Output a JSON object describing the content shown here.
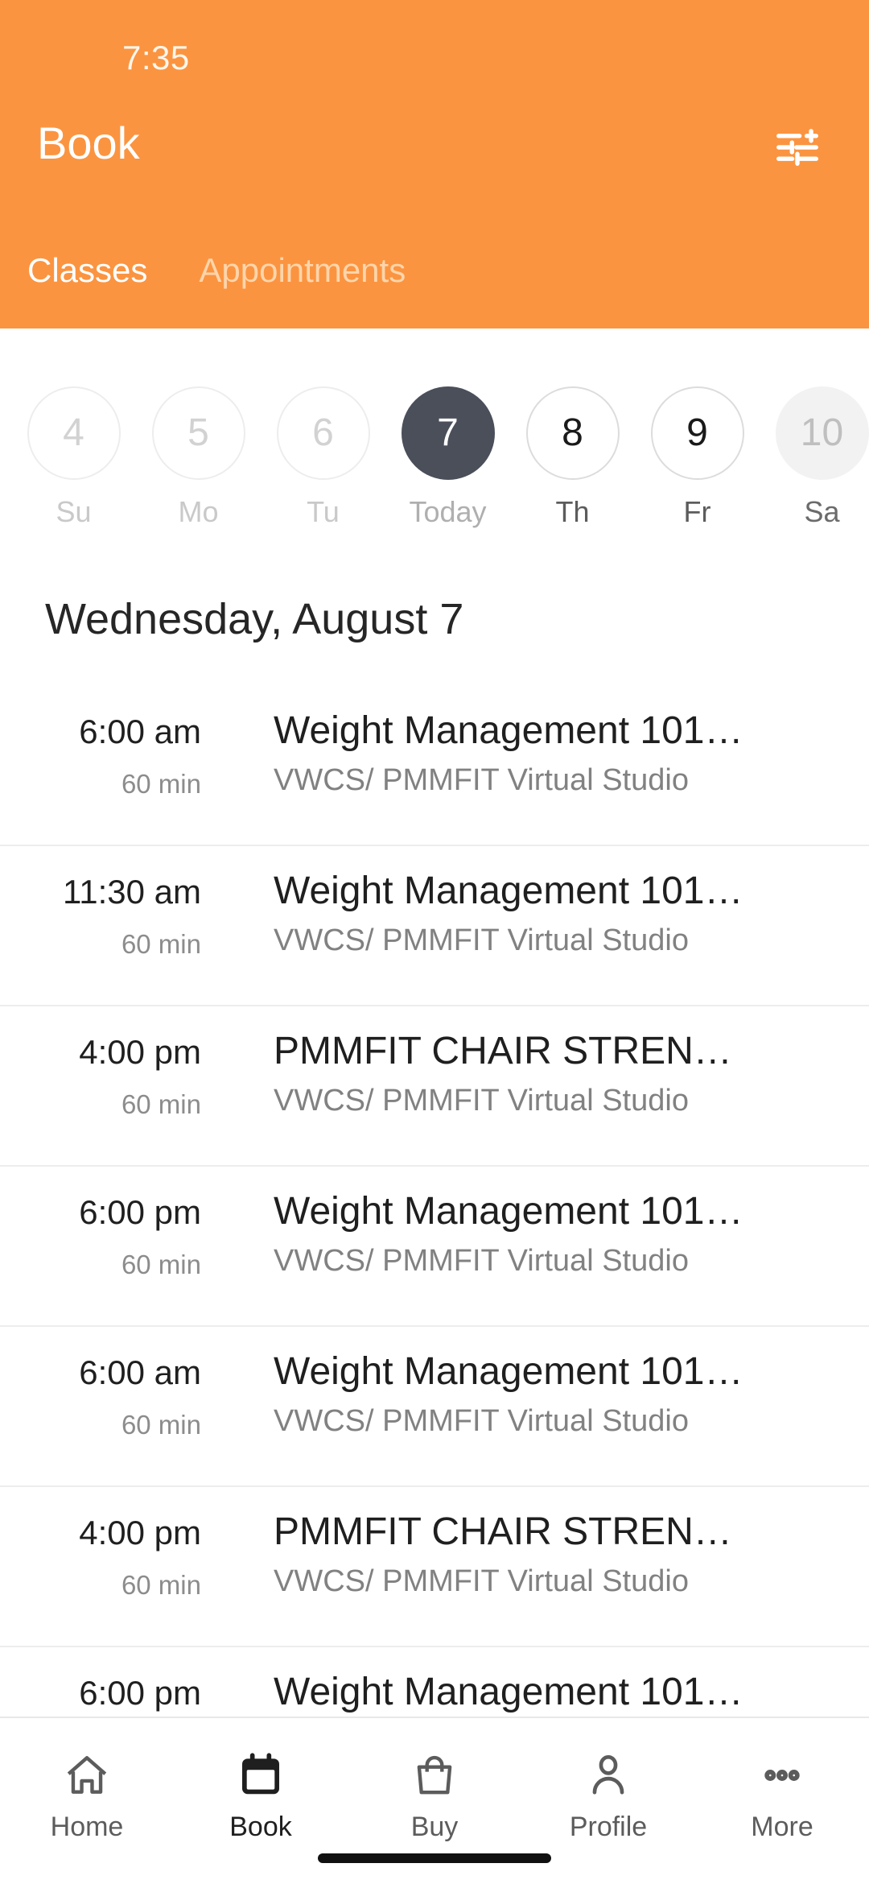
{
  "colors": {
    "brand_orange": "#FB9440",
    "selected_day": "#4A4F5A",
    "title_text": "#1F1F1F",
    "muted_text": "#818181",
    "divider": "#EDEDED"
  },
  "status_bar": {
    "time": "7:35"
  },
  "header": {
    "title": "Book",
    "filter_icon": "tune-sliders-icon",
    "tabs": [
      {
        "label": "Classes",
        "active": true
      },
      {
        "label": "Appointments",
        "active": false
      }
    ]
  },
  "date_strip": {
    "days": [
      {
        "date": "4",
        "weekday": "Su",
        "state": "past"
      },
      {
        "date": "5",
        "weekday": "Mo",
        "state": "past"
      },
      {
        "date": "6",
        "weekday": "Tu",
        "state": "past"
      },
      {
        "date": "7",
        "weekday": "Today",
        "state": "today"
      },
      {
        "date": "8",
        "weekday": "Th",
        "state": "future"
      },
      {
        "date": "9",
        "weekday": "Fr",
        "state": "future"
      },
      {
        "date": "10",
        "weekday": "Sa",
        "state": "edge"
      }
    ]
  },
  "day_heading": "Wednesday, August 7",
  "classes": [
    {
      "time": "6:00 am",
      "duration": "60 min",
      "title": "Weight Management 101…",
      "location": "VWCS/ PMMFIT Virtual Studio"
    },
    {
      "time": "11:30 am",
      "duration": "60 min",
      "title": "Weight Management 101…",
      "location": "VWCS/ PMMFIT Virtual Studio"
    },
    {
      "time": "4:00 pm",
      "duration": "60 min",
      "title": "PMMFIT CHAIR STREN…",
      "location": "VWCS/ PMMFIT Virtual Studio"
    },
    {
      "time": "6:00 pm",
      "duration": "60 min",
      "title": "Weight Management 101…",
      "location": "VWCS/ PMMFIT Virtual Studio"
    },
    {
      "time": "6:00 am",
      "duration": "60 min",
      "title": "Weight Management 101…",
      "location": "VWCS/ PMMFIT Virtual Studio"
    },
    {
      "time": "4:00 pm",
      "duration": "60 min",
      "title": "PMMFIT CHAIR STREN…",
      "location": "VWCS/ PMMFIT Virtual Studio"
    },
    {
      "time": "6:00 pm",
      "duration": "",
      "title": "Weight Management 101…",
      "location": ""
    }
  ],
  "bottom_nav": {
    "items": [
      {
        "label": "Home",
        "icon": "home-icon",
        "active": false
      },
      {
        "label": "Book",
        "icon": "calendar-icon",
        "active": true
      },
      {
        "label": "Buy",
        "icon": "bag-icon",
        "active": false
      },
      {
        "label": "Profile",
        "icon": "person-icon",
        "active": false
      },
      {
        "label": "More",
        "icon": "ellipsis-icon",
        "active": false
      }
    ]
  }
}
